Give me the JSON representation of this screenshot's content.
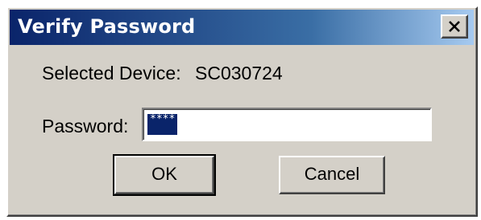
{
  "window": {
    "title": "Verify Password",
    "close_icon": "close-icon"
  },
  "device": {
    "label": "Selected Device:",
    "value": "SC030724"
  },
  "password": {
    "label": "Password:",
    "value": "****",
    "selected": true
  },
  "buttons": {
    "ok_label": "OK",
    "cancel_label": "Cancel"
  },
  "colors": {
    "dialog_face": "#d4d0c8",
    "title_start": "#0a246a",
    "title_end": "#a6caf0",
    "selection": "#0a246a"
  }
}
